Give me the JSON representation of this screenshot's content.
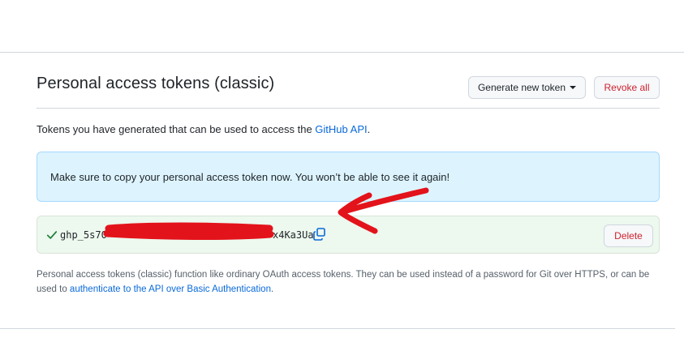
{
  "section": {
    "title": "Personal access tokens (classic)",
    "generate_label": "Generate new token",
    "revoke_label": "Revoke all"
  },
  "intro": {
    "prefix": "Tokens you have generated that can be used to access the ",
    "link": "GitHub API",
    "suffix": "."
  },
  "flash": {
    "message": "Make sure to copy your personal access token now. You won’t be able to see it again!"
  },
  "token": {
    "prefix_visible": "ghp_5s70",
    "suffix_visible": "x4Ka3Ua",
    "delete_label": "Delete",
    "check_icon": "check-icon",
    "copy_icon": "copy-icon"
  },
  "footnote": {
    "text": "Personal access tokens (classic) function like ordinary OAuth access tokens. They can be used instead of a password for Git over HTTPS, or can be used to ",
    "link": "authenticate to the API over Basic Authentication",
    "suffix": "."
  },
  "colors": {
    "accent": "#0969da",
    "danger": "#cf222e",
    "flash_bg": "#ddf4ff",
    "token_bg": "#edf8ee",
    "annotation": "#e3131b"
  }
}
